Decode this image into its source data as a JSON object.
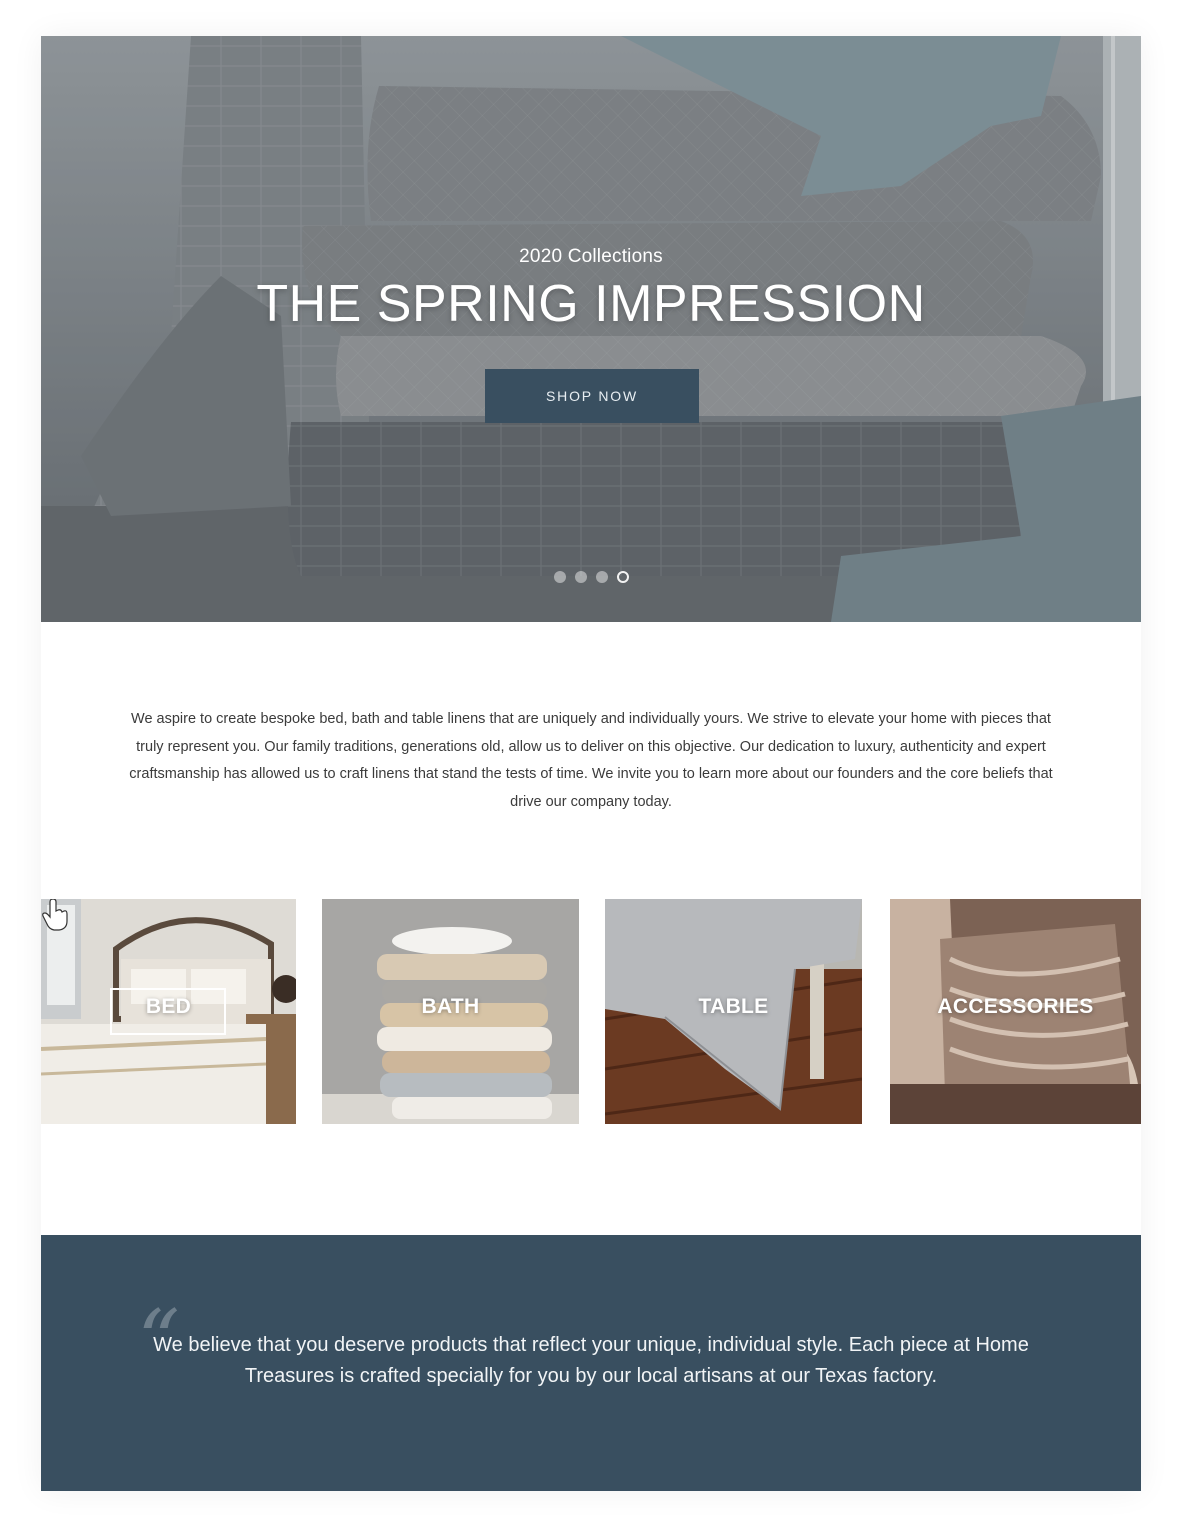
{
  "hero": {
    "subtitle": "2020 Collections",
    "title": "THE SPRING IMPRESSION",
    "cta_label": "SHOP NOW",
    "slides": [
      {
        "active": false
      },
      {
        "active": false
      },
      {
        "active": false
      },
      {
        "active": true
      }
    ]
  },
  "intro": {
    "text": "We aspire to create bespoke bed, bath and table linens that are uniquely and individually yours. We strive to elevate your home with pieces that truly represent you. Our family traditions, generations old, allow us to deliver on this objective. Our dedication to luxury, authenticity and expert craftsmanship has allowed us to craft linens that stand the tests of time. We invite you to learn more about our founders and the core beliefs that drive our company today."
  },
  "categories": [
    {
      "label": "BED"
    },
    {
      "label": "BATH"
    },
    {
      "label": "TABLE"
    },
    {
      "label": "ACCESSORIES"
    }
  ],
  "quote": {
    "mark": "“",
    "text": "We believe that you deserve products that reflect your unique, individual style. Each piece at Home Treasures is crafted specially for you by our local artisans at our Texas factory."
  },
  "colors": {
    "accent": "#394f60",
    "text": "#3b3b3b",
    "background": "#ffffff"
  },
  "icons": {
    "cursor": "hand-pointer-icon"
  }
}
